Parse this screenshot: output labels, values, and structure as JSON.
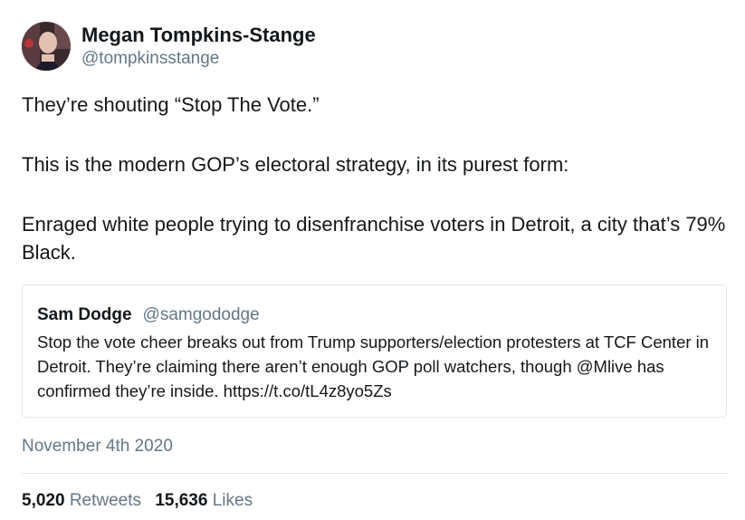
{
  "author": {
    "display_name": "Megan Tompkins-Stange",
    "handle": "@tompkinsstange"
  },
  "tweet": {
    "paragraphs": [
      "They’re shouting “Stop The Vote.”",
      "This is the modern GOP’s electoral strategy, in its purest form:",
      "Enraged white people trying to disenfranchise voters in Detroit, a city that’s 79% Black."
    ]
  },
  "quoted_tweet": {
    "display_name": "Sam Dodge",
    "handle": "@samgododge",
    "text": "Stop the vote cheer breaks out from Trump supporters/election protesters at TCF Center in Detroit. They’re claiming there aren’t enough GOP poll watchers, though @Mlive has confirmed they’re inside. https://t.co/tL4z8yo5Zs"
  },
  "timestamp": "November 4th 2020",
  "stats": {
    "retweets_count": "5,020",
    "retweets_label": "Retweets",
    "likes_count": "15,636",
    "likes_label": "Likes"
  },
  "colors": {
    "text_primary": "#14171a",
    "text_secondary": "#657786",
    "border": "#e1e8ed"
  }
}
